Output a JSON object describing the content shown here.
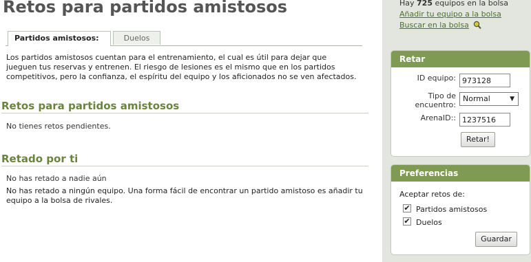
{
  "main": {
    "title": "Retos para partidos amistosos",
    "tabs": [
      {
        "label": "Partidos amistosos:",
        "active": true
      },
      {
        "label": "Duelos",
        "active": false
      }
    ],
    "intro": "Los partidos amistosos cuentan para el entrenamiento, el cual es útil para dejar que jueguen tus reservas y entrenen. El riesgo de lesiones es el mismo que en los partidos competitivos, pero la confianza, el espíritu del equipo y los aficionados no se ven afectados.",
    "section_retos": {
      "title": "Retos para partidos amistosos",
      "empty_text": "No tienes retos pendientes."
    },
    "section_retado": {
      "title": "Retado por ti",
      "line1": "No has retado a nadie aún",
      "line2": "No has retado a ningún equipo. Una forma fácil de encontrar un partido amistoso es añadir tu equipo a la bolsa de rivales."
    }
  },
  "sidebar": {
    "bolsa": {
      "prefix": "Hay ",
      "count": "725",
      "suffix": " equipos en la bolsa",
      "add_link": "Añadir tu equipo a la bolsa",
      "search_link": "Buscar en la bolsa"
    },
    "retar": {
      "header": "Retar",
      "team_id_label": "ID equipo:",
      "team_id_value": "973128",
      "match_type_label": "Tipo de encuentro:",
      "match_type_value": "Normal",
      "arena_label": "ArenaID::",
      "arena_value": "1237516",
      "submit": "Retar!"
    },
    "preferencias": {
      "header": "Preferencias",
      "accept_label": "Aceptar retos de:",
      "options": [
        {
          "label": "Partidos amistosos",
          "checked": true
        },
        {
          "label": "Duelos",
          "checked": true
        }
      ],
      "save": "Guardar"
    }
  },
  "colors": {
    "accent": "#7f9a53",
    "title_green": "#6a843e",
    "sidebar_bg": "#e3e6df"
  }
}
